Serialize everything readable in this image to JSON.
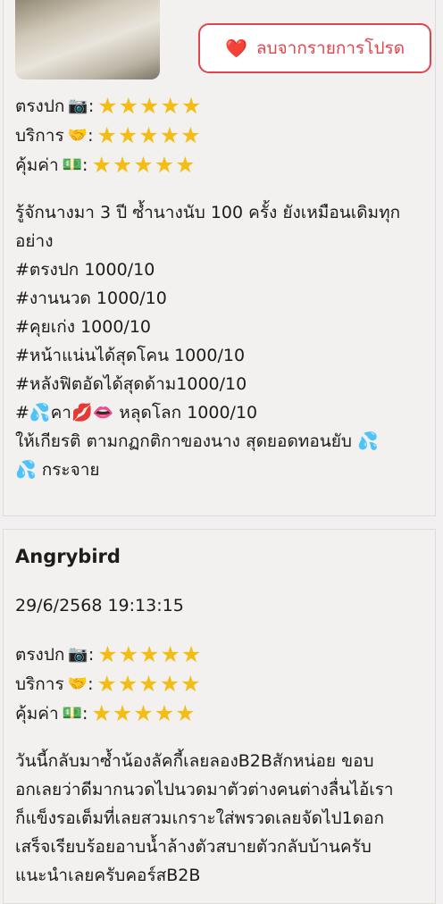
{
  "post1": {
    "fav_label": "ลบจากรายการโปรด",
    "ratings": [
      {
        "label": "ตรงปก",
        "emoji": "📷",
        "stars": 5
      },
      {
        "label": "บริการ",
        "emoji": "🤝",
        "stars": 5
      },
      {
        "label": "คุ้มค่า",
        "emoji": "💵",
        "stars": 5
      }
    ],
    "review_lines": [
      "รู้จักนางมา 3 ปี ซ้ำนางนับ 100 ครั้ง ยังเหมือนเดิมทุก",
      "อย่าง",
      "#ตรงปก 1000/10",
      "#งานนวด 1000/10",
      "#คุยเก่ง 1000/10",
      "#หน้าแน่นได้สุดโคน 1000/10",
      "#หลังฟิตอัดได้สุดด้าม1000/10",
      "#💦คา💋👄 หลุดโลก 1000/10",
      "ให้เกียรติ ตามกฏกติกาของนาง สุดยอดทอนยับ 💦",
      "💦 กระจาย"
    ]
  },
  "post2": {
    "author": "Angrybird",
    "date": "29/6/2568 19:13:15",
    "ratings": [
      {
        "label": "ตรงปก",
        "emoji": "📷",
        "stars": 5
      },
      {
        "label": "บริการ",
        "emoji": "🤝",
        "stars": 5
      },
      {
        "label": "คุ้มค่า",
        "emoji": "💵",
        "stars": 5
      }
    ],
    "review_lines": [
      "วันนี้กลับมาซ้ำน้องลัคกี้เลยลองB2Bสักหน่อย ขอบ",
      "อกเลยว่าดีมากนวดไปนวดมาตัวต่างคนต่างลื่นไอ้เรา",
      "ก็แข็งรอเต็มที่เลยสวมเกราะใส่พรวดเลยจัดไป1ดอก",
      "เสร็จเรียบร้อยอาบน้ำล้างตัวสบายตัวกลับบ้านครับ",
      "แนะนำเลยครับคอร์สB2B"
    ]
  },
  "colors": {
    "accent": "#e0454d",
    "star": "#f4bd15"
  }
}
